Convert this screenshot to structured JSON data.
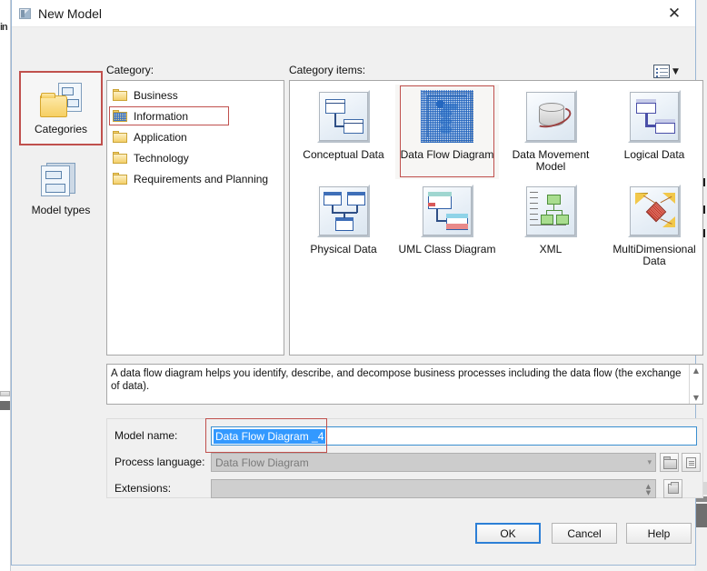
{
  "window": {
    "title": "New Model",
    "title_icon": "window-icon",
    "close_icon": "close-icon"
  },
  "rail": {
    "items": [
      {
        "label": "Categories",
        "icon": "categories-icon",
        "selected": true
      },
      {
        "label": "Model types",
        "icon": "model-types-icon",
        "selected": false
      }
    ]
  },
  "labels": {
    "category": "Category:",
    "category_items": "Category items:"
  },
  "view_mode": {
    "icon": "list-view-icon",
    "caret": "▼"
  },
  "categories": {
    "items": [
      {
        "label": "Business",
        "icon": "folder-icon",
        "selected": false
      },
      {
        "label": "Information",
        "icon": "folder-icon",
        "selected": true
      },
      {
        "label": "Application",
        "icon": "folder-icon",
        "selected": false
      },
      {
        "label": "Technology",
        "icon": "folder-icon",
        "selected": false
      },
      {
        "label": "Requirements and Planning",
        "icon": "folder-icon",
        "selected": false
      }
    ]
  },
  "category_items": {
    "items": [
      {
        "label": "Conceptual Data",
        "icon": "conceptual-data-icon",
        "selected": false
      },
      {
        "label": "Data Flow Diagram",
        "icon": "data-flow-diagram-icon",
        "selected": true
      },
      {
        "label": "Data Movement Model",
        "icon": "data-movement-model-icon",
        "selected": false
      },
      {
        "label": "Logical Data",
        "icon": "logical-data-icon",
        "selected": false
      },
      {
        "label": "Physical Data",
        "icon": "physical-data-icon",
        "selected": false
      },
      {
        "label": "UML Class Diagram",
        "icon": "uml-class-diagram-icon",
        "selected": false
      },
      {
        "label": "XML",
        "icon": "xml-icon",
        "selected": false
      },
      {
        "label": "MultiDimensional Data",
        "icon": "multidimensional-data-icon",
        "selected": false
      }
    ]
  },
  "description": {
    "text": "A data flow diagram helps you identify, describe, and decompose business processes including the data flow (the exchange of data).",
    "scroll_up": "▲",
    "scroll_down": "▼"
  },
  "form": {
    "model_name_label": "Model name:",
    "model_name_value": "Data Flow Diagram _4",
    "process_language_label": "Process language:",
    "process_language_value": "Data Flow Diagram",
    "process_language_caret": "▾",
    "process_language_browse_icon": "folder-open-icon",
    "process_language_new_icon": "new-document-icon",
    "extensions_label": "Extensions:",
    "extensions_value": "",
    "extensions_spin_up": "▲",
    "extensions_spin_down": "▼",
    "extensions_browse_icon": "extensions-browse-icon"
  },
  "footer": {
    "ok": "OK",
    "cancel": "Cancel",
    "help": "Help"
  },
  "background": {
    "left_text": "in"
  },
  "colors": {
    "accent": "#2c7fd6",
    "selection_red": "#c0504d",
    "text_selection_blue": "#3399ff",
    "dialog_bg": "#f0f0f0"
  }
}
